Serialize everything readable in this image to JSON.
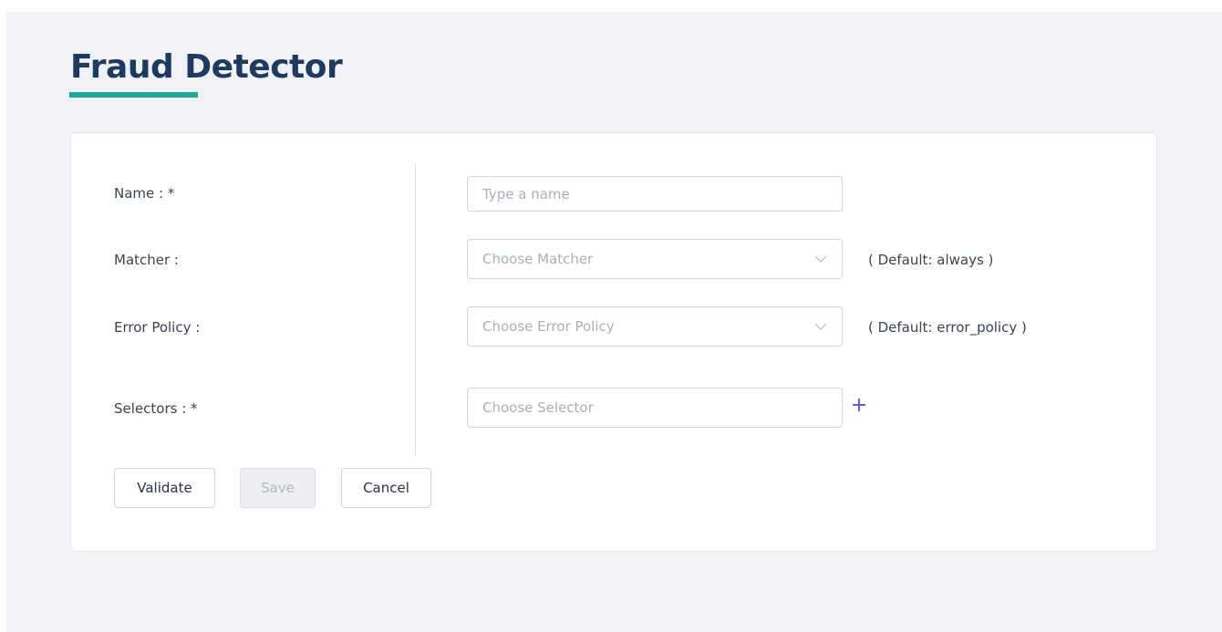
{
  "page": {
    "title": "Fraud Detector"
  },
  "form": {
    "name": {
      "label": "Name : *",
      "placeholder": "Type a name",
      "value": ""
    },
    "matcher": {
      "label": "Matcher :",
      "placeholder": "Choose Matcher",
      "hint": "( Default: always )"
    },
    "error_policy": {
      "label": "Error Policy :",
      "placeholder": "Choose Error Policy",
      "hint": "( Default: error_policy )"
    },
    "selectors": {
      "label": "Selectors : *",
      "placeholder": "Choose Selector"
    }
  },
  "actions": {
    "validate_label": "Validate",
    "save_label": "Save",
    "cancel_label": "Cancel"
  },
  "icons": {
    "dropdown": "chevron-down-icon",
    "add": "plus-icon"
  },
  "colors": {
    "title": "#1f3a5f",
    "accent_underline": "#1fa795",
    "add_icon": "#4a4fd8",
    "background": "#f0f2f6"
  }
}
